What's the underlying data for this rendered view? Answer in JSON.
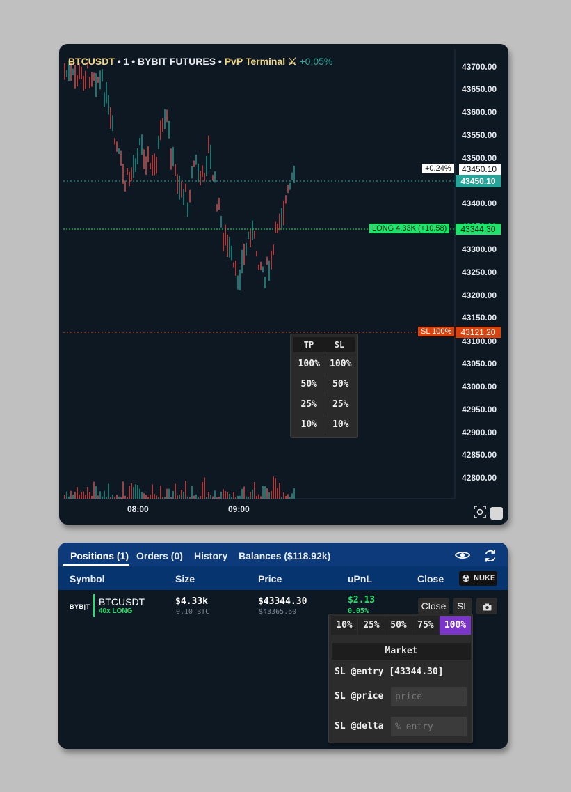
{
  "chart": {
    "symbol": "BTCUSDT",
    "title_rest": " • 1 • BYBIT FUTURES • ",
    "terminal": "PvP Terminal",
    "terminal_icon": "crossed-swords-icon",
    "change": "+0.05%",
    "price_axis": [
      "43700.00",
      "43650.00",
      "43600.00",
      "43550.00",
      "43500.00",
      "43400.00",
      "43350.00",
      "43300.00",
      "43250.00",
      "43200.00",
      "43150.00",
      "43100.00",
      "43050.00",
      "43000.00",
      "42950.00",
      "42900.00",
      "42850.00",
      "42800.00"
    ],
    "time_axis": [
      "08:00",
      "09:00"
    ],
    "hover_change": "+0.24%",
    "hover_price": "43450.10",
    "last_price": "43450.10",
    "position_label": "LONG 4.33K (+10.58)",
    "position_price": "43344.30",
    "sl_label": "SL 100%",
    "sl_price": "43121.20",
    "colors": {
      "up": "#26a69a",
      "down": "#ef5350",
      "long": "#1de46a",
      "sl": "#d8430e"
    }
  },
  "tpsl_menu": {
    "headers": [
      "TP",
      "SL"
    ],
    "rows": [
      [
        "100%",
        "100%"
      ],
      [
        "50%",
        "50%"
      ],
      [
        "25%",
        "25%"
      ],
      [
        "10%",
        "10%"
      ]
    ]
  },
  "positions": {
    "tabs": [
      "Positions (1)",
      "Orders (0)",
      "History",
      "Balances ($118.92k)"
    ],
    "columns": [
      "Symbol",
      "Size",
      "Price",
      "uPnL",
      "Close"
    ],
    "nuke_label": "NUKE",
    "row": {
      "exchange": "BYB|T",
      "symbol": "BTCUSDT",
      "leverage": "40x LONG",
      "size": "$4.33k",
      "size_sub": "0.10 BTC",
      "price": "$43344.30",
      "price_sub": "$43365.60",
      "upnl": "$2.13",
      "upnl_sub": "0.05%",
      "close_btn": "Close",
      "sl_btn": "SL"
    }
  },
  "sl_menu": {
    "pcts": [
      "10%",
      "25%",
      "50%",
      "75%",
      "100%"
    ],
    "active_pct": "100%",
    "market": "Market",
    "entry": "SL @entry [43344.30]",
    "price_label": "SL @price",
    "price_placeholder": "price",
    "delta_label": "SL @delta",
    "delta_placeholder": "% entry"
  }
}
